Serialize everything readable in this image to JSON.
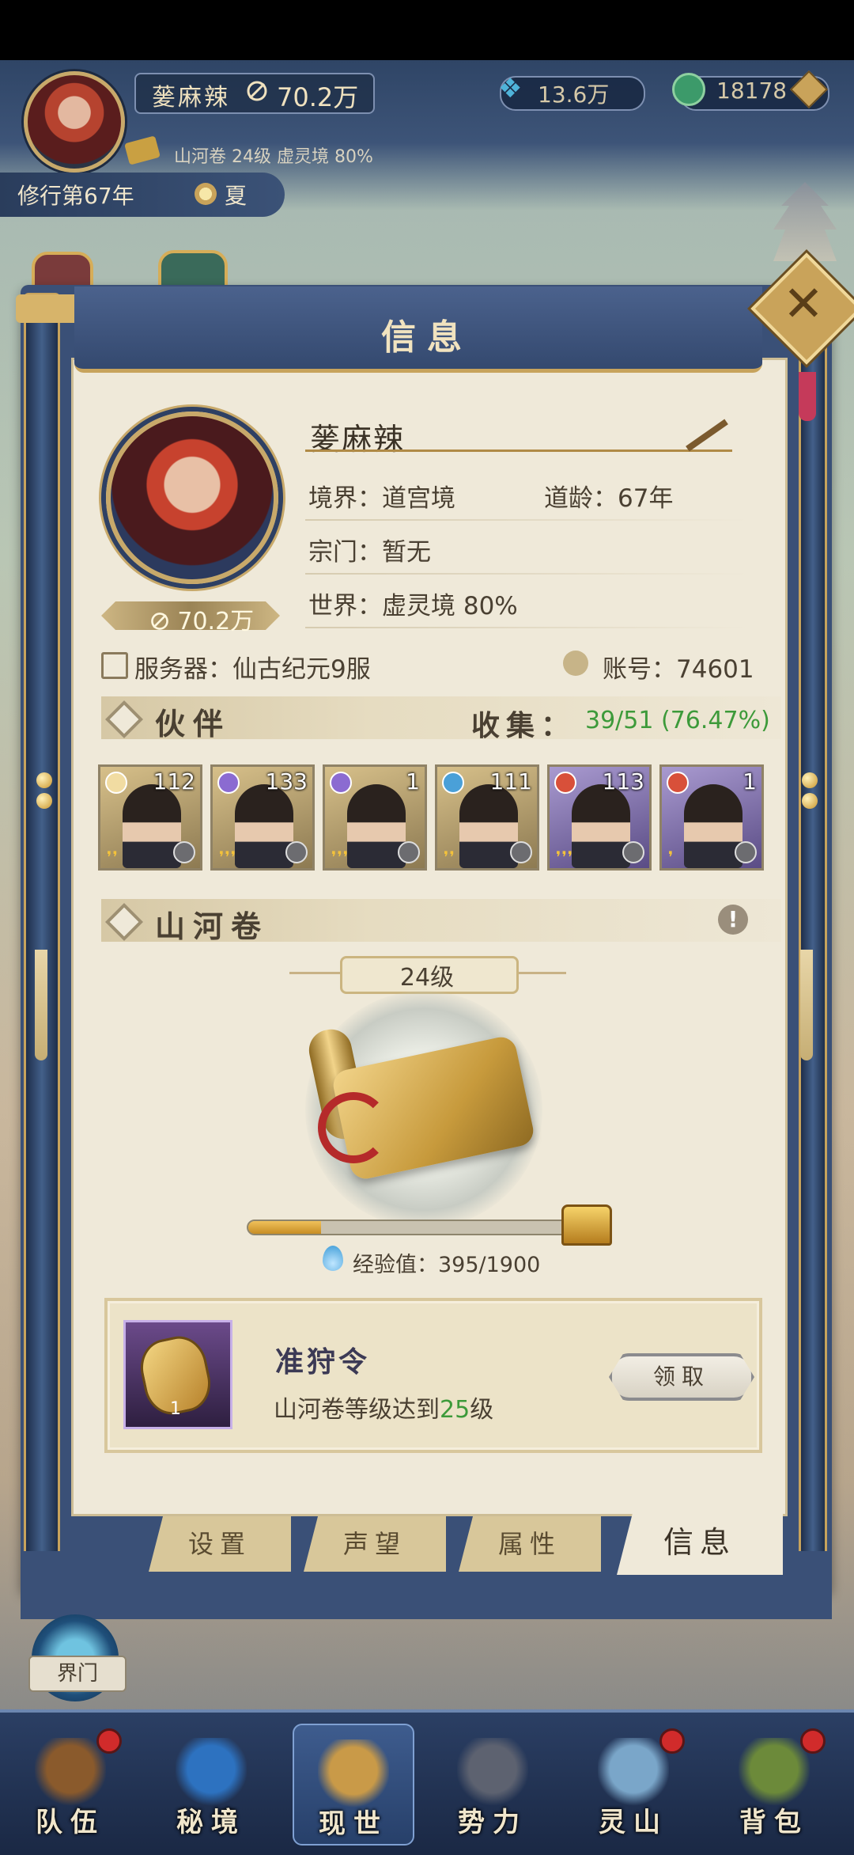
{
  "player": {
    "name": "蓌麻辣",
    "power": "70.2万",
    "scroll_info": "山河卷 24级 虚灵境 80%",
    "year": "修行第67年",
    "season": "夏"
  },
  "resources": {
    "spirit_stone": "13.6万",
    "jade": "18178"
  },
  "panel": {
    "title": "信息",
    "name": "蓌麻辣",
    "realm_label": "境界：道宫境",
    "age_label": "道龄：67年",
    "sect_label": "宗门：暂无",
    "world_label": "世界：虚灵境 80%",
    "power": "70.2万",
    "server_label": "服务器：仙古纪元9服",
    "account_label": "账号：74601",
    "partners_title": "伙伴",
    "collect_label": "收集：",
    "collect_value": "39/51 (76.47%)",
    "partners": [
      {
        "level": "112",
        "stars": 2,
        "element": "light",
        "bg": "gold"
      },
      {
        "level": "133",
        "stars": 3,
        "element": "void",
        "bg": "gold"
      },
      {
        "level": "1",
        "stars": 3,
        "element": "void",
        "bg": "gold"
      },
      {
        "level": "111",
        "stars": 2,
        "element": "water",
        "bg": "gold"
      },
      {
        "level": "113",
        "stars": 3,
        "element": "fire",
        "bg": "purple"
      },
      {
        "level": "1",
        "stars": 1,
        "element": "fire",
        "bg": "purple"
      }
    ],
    "scroll_title": "山河卷",
    "scroll_level": "24级",
    "exp_label": "经验值：395/1900",
    "exp_progress": 0.208,
    "quest": {
      "title": "准狩令",
      "count": "1",
      "desc_prefix": "山河卷等级达到",
      "desc_value": "25",
      "desc_suffix": "级",
      "button": "领取"
    }
  },
  "tabs": [
    {
      "label": "设置",
      "active": false
    },
    {
      "label": "声望",
      "active": false
    },
    {
      "label": "属性",
      "active": false
    },
    {
      "label": "信息",
      "active": true
    }
  ],
  "portal_label": "界门",
  "nav": [
    {
      "label": "队伍",
      "dot": true,
      "active": false,
      "color": "#8a5a2c"
    },
    {
      "label": "秘境",
      "dot": false,
      "active": false,
      "color": "#2d72c0"
    },
    {
      "label": "现世",
      "dot": false,
      "active": true,
      "color": "#c99a48"
    },
    {
      "label": "势力",
      "dot": false,
      "active": false,
      "color": "#5d6270"
    },
    {
      "label": "灵山",
      "dot": true,
      "active": false,
      "color": "#7aa6c9"
    },
    {
      "label": "背包",
      "dot": true,
      "active": false,
      "color": "#6c8a3a"
    }
  ],
  "colors": {
    "accent_green": "#3d9a3a",
    "panel_blue": "#3a5077",
    "parchment": "#efe9d9",
    "gold_trim": "#c7a35c"
  }
}
